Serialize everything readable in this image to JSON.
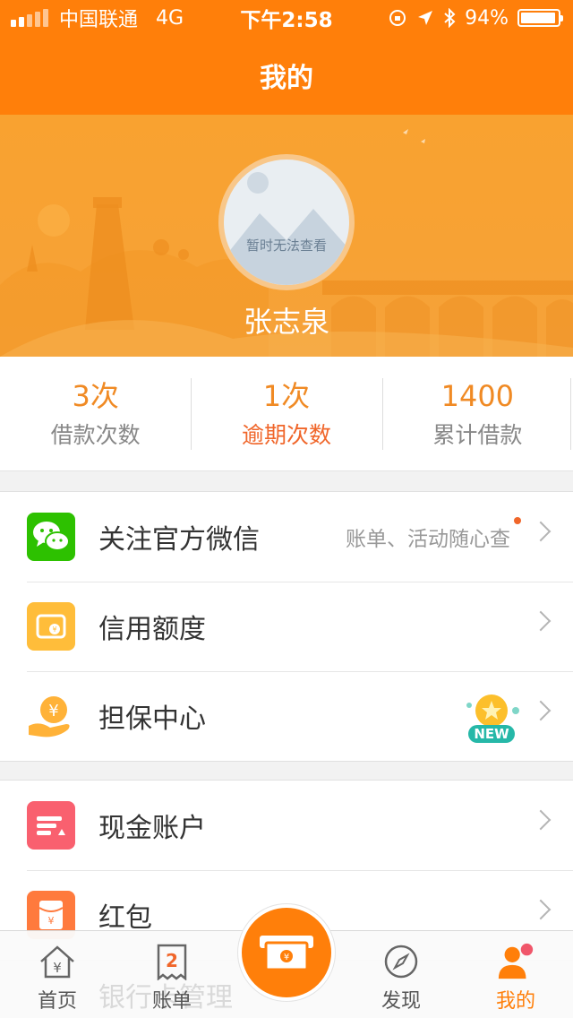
{
  "status_bar": {
    "carrier": "中国联通",
    "network": "4G",
    "time": "下午2:58",
    "battery_text": "94%",
    "battery_level": 0.94
  },
  "nav": {
    "title": "我的"
  },
  "profile": {
    "avatar_text": "暂时无法查看",
    "username": "张志泉"
  },
  "stats": [
    {
      "value": "3次",
      "label": "借款次数"
    },
    {
      "value": "1次",
      "label": "逾期次数"
    },
    {
      "value": "1400",
      "label": "累计借款"
    }
  ],
  "menu_group_1": [
    {
      "title": "关注官方微信",
      "hint": "账单、活动随心查",
      "icon": "wechat-icon",
      "color": "#2dc100"
    },
    {
      "title": "信用额度",
      "hint": "",
      "icon": "credit-card-icon",
      "color": "#ffbd3a"
    },
    {
      "title": "担保中心",
      "hint": "",
      "icon": "hand-coin-icon",
      "color": "#ffb238",
      "badge": "NEW"
    }
  ],
  "menu_group_2": [
    {
      "title": "现金账户",
      "icon": "cash-account-icon",
      "color": "#f9606f"
    },
    {
      "title": "红包",
      "icon": "red-envelope-icon",
      "color": "#ff7a3d"
    }
  ],
  "behind_text": "银行卡管理",
  "tabbar": [
    {
      "label": "首页",
      "icon": "home-yen-icon"
    },
    {
      "label": "账单",
      "icon": "bill-icon",
      "count": "2"
    },
    {
      "label": "",
      "icon": "cash-machine-icon"
    },
    {
      "label": "发现",
      "icon": "compass-icon"
    },
    {
      "label": "我的",
      "icon": "user-icon"
    }
  ],
  "colors": {
    "brand": "#ff7f0a",
    "accent_text": "#f08a24",
    "alert": "#f0662a"
  }
}
